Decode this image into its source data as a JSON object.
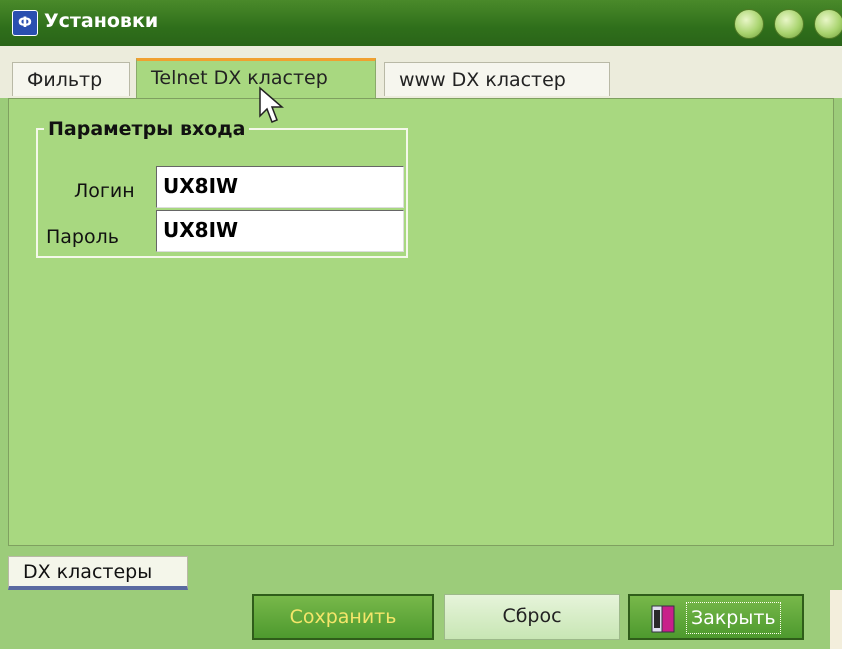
{
  "window": {
    "title": "Установки"
  },
  "tabs": [
    {
      "label": "Фильтр",
      "active": false
    },
    {
      "label": "Telnet DX кластер",
      "active": true
    },
    {
      "label": "www DX кластер",
      "active": false
    }
  ],
  "login_group": {
    "title": "Параметры входа",
    "login_label": "Логин",
    "login_value": "UX8IW",
    "password_label": "Пароль",
    "password_value": "UX8IW"
  },
  "bottom_tab": {
    "label": "DX кластеры"
  },
  "buttons": {
    "save": "Сохранить",
    "reset": "Сброс",
    "close": "Закрыть"
  }
}
